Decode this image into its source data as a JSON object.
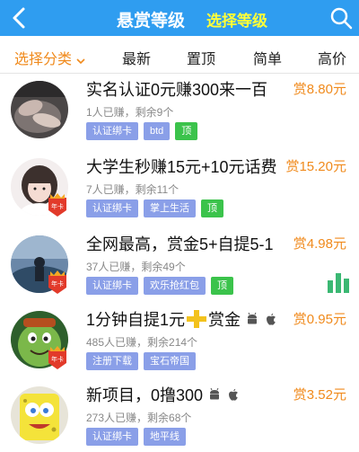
{
  "header": {
    "title": "悬赏等级",
    "subtitle": "选择等级"
  },
  "filters": {
    "category": "选择分类",
    "newest": "最新",
    "top": "置顶",
    "simple": "简单",
    "high_price": "高价"
  },
  "tasks": [
    {
      "title": "实名认证0元赚300来一百",
      "reward": "赏8.80元",
      "meta": "1人已赚，剩余9个",
      "tags": [
        "认证绑卡",
        "btd",
        "顶"
      ],
      "year_badge": false
    },
    {
      "title": "大学生秒赚15元+10元话费",
      "reward": "赏15.20元",
      "meta": "7人已赚，剩余11个",
      "tags": [
        "认证绑卡",
        "掌上生活",
        "顶"
      ],
      "year_badge": "年卡"
    },
    {
      "title": "全网最高，赏金5+自提5-1",
      "reward": "赏4.98元",
      "meta": "37人已赚，剩余49个",
      "tags": [
        "认证绑卡",
        "欢乐抢红包",
        "顶"
      ],
      "year_badge": "年卡"
    },
    {
      "title": "1分钟自提1元",
      "title_suffix": "赏金",
      "reward": "赏0.95元",
      "meta": "485人已赚，剩余214个",
      "tags": [
        "注册下载",
        "宝石帝国"
      ],
      "year_badge": "年卡"
    },
    {
      "title": "新项目，0撸300",
      "reward": "赏3.52元",
      "meta": "273人已赚，剩余68个",
      "tags": [
        "认证绑卡",
        "地平线"
      ],
      "year_badge": false
    }
  ],
  "icons": {
    "back": "back-arrow-icon",
    "search": "search-icon",
    "android": "android-icon",
    "apple": "apple-icon",
    "stats": "bar-chart-icon"
  },
  "colors": {
    "header_bg": "#2f9df0",
    "accent_orange": "#f08a1c",
    "tag_blue": "#8a9fe8",
    "tag_green": "#3bc34b"
  }
}
